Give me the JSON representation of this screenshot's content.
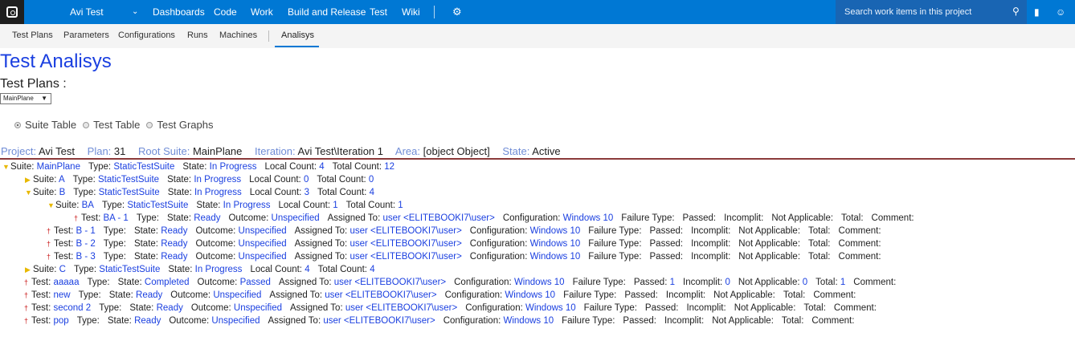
{
  "topbar": {
    "project": "Avi Test",
    "nav": [
      "Dashboards",
      "Code",
      "Work",
      "Build and Release",
      "Test",
      "Wiki"
    ],
    "search_placeholder": "Search work items in this project"
  },
  "subnav": {
    "items": [
      "Test Plans",
      "Parameters",
      "Configurations",
      "Runs",
      "Machines"
    ],
    "active": "Analisys"
  },
  "page": {
    "title": "Test Analisys",
    "plans_label": "Test Plans :",
    "plan_selected": "MainPlane"
  },
  "radios": [
    {
      "label": "Suite Table",
      "checked": true
    },
    {
      "label": "Test Table",
      "checked": false
    },
    {
      "label": "Test Graphs",
      "checked": false
    }
  ],
  "info": {
    "project_k": "Project:",
    "project_v": "Avi Test",
    "plan_k": "Plan:",
    "plan_v": "31",
    "root_k": "Root Suite:",
    "root_v": "MainPlane",
    "iter_k": "Iteration:",
    "iter_v": "Avi Test\\Iteration 1",
    "area_k": "Area:",
    "area_v": "[object Object]",
    "state_k": "State:",
    "state_v": "Active"
  },
  "labels": {
    "suite": "Suite:",
    "test": "Test:",
    "type": "Type:",
    "state": "State:",
    "local": "Local Count:",
    "total": "Total Count:",
    "outcome": "Outcome:",
    "assigned": "Assigned To:",
    "config": "Configuration:",
    "failure": "Failure Type:",
    "passed": "Passed:",
    "incomplit": "Incomplit:",
    "na": "Not Applicable:",
    "totalc": "Total:",
    "comment": "Comment:"
  },
  "rows": [
    {
      "kind": "suite",
      "indent": 0,
      "open": true,
      "name": "MainPlane",
      "type": "StaticTestSuite",
      "state": "In Progress",
      "local": "4",
      "total": "12"
    },
    {
      "kind": "suite",
      "indent": 1,
      "open": false,
      "name": "A",
      "type": "StaticTestSuite",
      "state": "In Progress",
      "local": "0",
      "total": "0"
    },
    {
      "kind": "suite",
      "indent": 1,
      "open": true,
      "name": "B",
      "type": "StaticTestSuite",
      "state": "In Progress",
      "local": "3",
      "total": "4"
    },
    {
      "kind": "suite",
      "indent": 2,
      "open": true,
      "name": "BA",
      "type": "StaticTestSuite",
      "state": "In Progress",
      "local": "1",
      "total": "1"
    },
    {
      "kind": "test",
      "indent": 3,
      "name": "BA - 1",
      "state": "Ready",
      "outcome": "Unspecified",
      "assigned": "user <ELITEBOOKI7\\user>",
      "config": "Windows 10",
      "passed": "",
      "incomplit": "",
      "na": "",
      "totalc": ""
    },
    {
      "kind": "test",
      "indent": 2,
      "name": "B - 1",
      "state": "Ready",
      "outcome": "Unspecified",
      "assigned": "user <ELITEBOOKI7\\user>",
      "config": "Windows 10",
      "passed": "",
      "incomplit": "",
      "na": "",
      "totalc": ""
    },
    {
      "kind": "test",
      "indent": 2,
      "name": "B - 2",
      "state": "Ready",
      "outcome": "Unspecified",
      "assigned": "user <ELITEBOOKI7\\user>",
      "config": "Windows 10",
      "passed": "",
      "incomplit": "",
      "na": "",
      "totalc": ""
    },
    {
      "kind": "test",
      "indent": 2,
      "name": "B - 3",
      "state": "Ready",
      "outcome": "Unspecified",
      "assigned": "user <ELITEBOOKI7\\user>",
      "config": "Windows 10",
      "passed": "",
      "incomplit": "",
      "na": "",
      "totalc": ""
    },
    {
      "kind": "suite",
      "indent": 1,
      "open": false,
      "name": "C",
      "type": "StaticTestSuite",
      "state": "In Progress",
      "local": "4",
      "total": "4"
    },
    {
      "kind": "test",
      "indent": 1,
      "name": "aaaaa",
      "state": "Completed",
      "outcome": "Passed",
      "assigned": "user <ELITEBOOKI7\\user>",
      "config": "Windows 10",
      "passed": "1",
      "incomplit": "0",
      "na": "0",
      "totalc": "1"
    },
    {
      "kind": "test",
      "indent": 1,
      "name": "new",
      "state": "Ready",
      "outcome": "Unspecified",
      "assigned": "user <ELITEBOOKI7\\user>",
      "config": "Windows 10",
      "passed": "",
      "incomplit": "",
      "na": "",
      "totalc": ""
    },
    {
      "kind": "test",
      "indent": 1,
      "name": "second 2",
      "state": "Ready",
      "outcome": "Unspecified",
      "assigned": "user <ELITEBOOKI7\\user>",
      "config": "Windows 10",
      "passed": "",
      "incomplit": "",
      "na": "",
      "totalc": ""
    },
    {
      "kind": "test",
      "indent": 1,
      "name": "pop",
      "state": "Ready",
      "outcome": "Unspecified",
      "assigned": "user <ELITEBOOKI7\\user>",
      "config": "Windows 10",
      "passed": "",
      "incomplit": "",
      "na": "",
      "totalc": ""
    }
  ]
}
